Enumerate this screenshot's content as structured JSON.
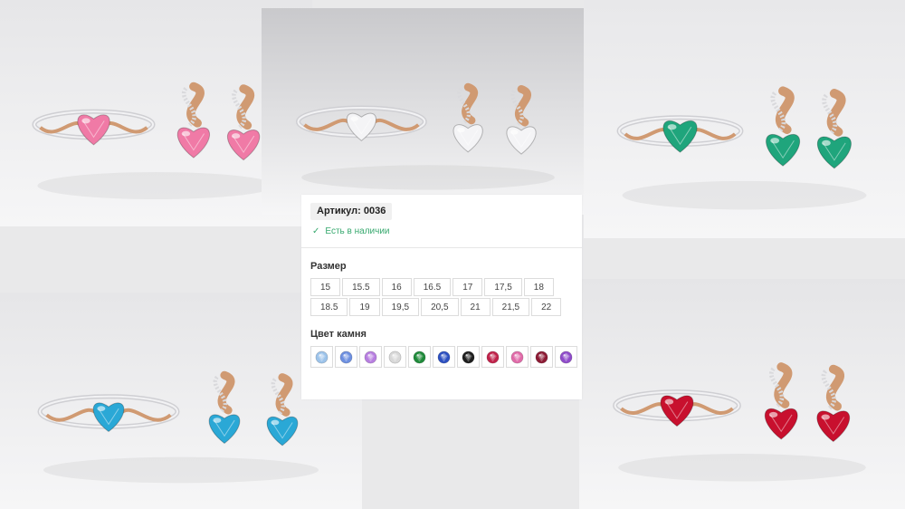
{
  "product": {
    "article_label": "Артикул: 0036",
    "stock_icon": "check-icon",
    "stock_text": "Есть в наличии"
  },
  "size_section": {
    "title": "Размер",
    "sizes": [
      "15",
      "15.5",
      "16",
      "16.5",
      "17",
      "17,5",
      "18",
      "18.5",
      "19",
      "19,5",
      "20,5",
      "21",
      "21,5",
      "22"
    ]
  },
  "color_section": {
    "title": "Цвет камня",
    "colors": [
      "#9cc3ea",
      "#6d8fe0",
      "#b77ee0",
      "#d8d8d8",
      "#1f8a3a",
      "#2c4fc0",
      "#1e1e1e",
      "#c0224a",
      "#e06aa8",
      "#8c1a34",
      "#8e4bc9"
    ]
  },
  "photos": [
    {
      "name": "pink-set-photo",
      "stone": "#f07aa6",
      "bg": "#e6e6e8"
    },
    {
      "name": "clear-set-photo",
      "stone": "#f4f4f6",
      "bg": "#c9c9cc"
    },
    {
      "name": "green-set-photo",
      "stone": "#1fa57c",
      "bg": "#e8e8ea"
    },
    {
      "name": "blue-set-photo",
      "stone": "#2aa8d6",
      "bg": "#e6e6e8"
    },
    {
      "name": "red-set-photo",
      "stone": "#c8102e",
      "bg": "#e5e5e7"
    }
  ]
}
